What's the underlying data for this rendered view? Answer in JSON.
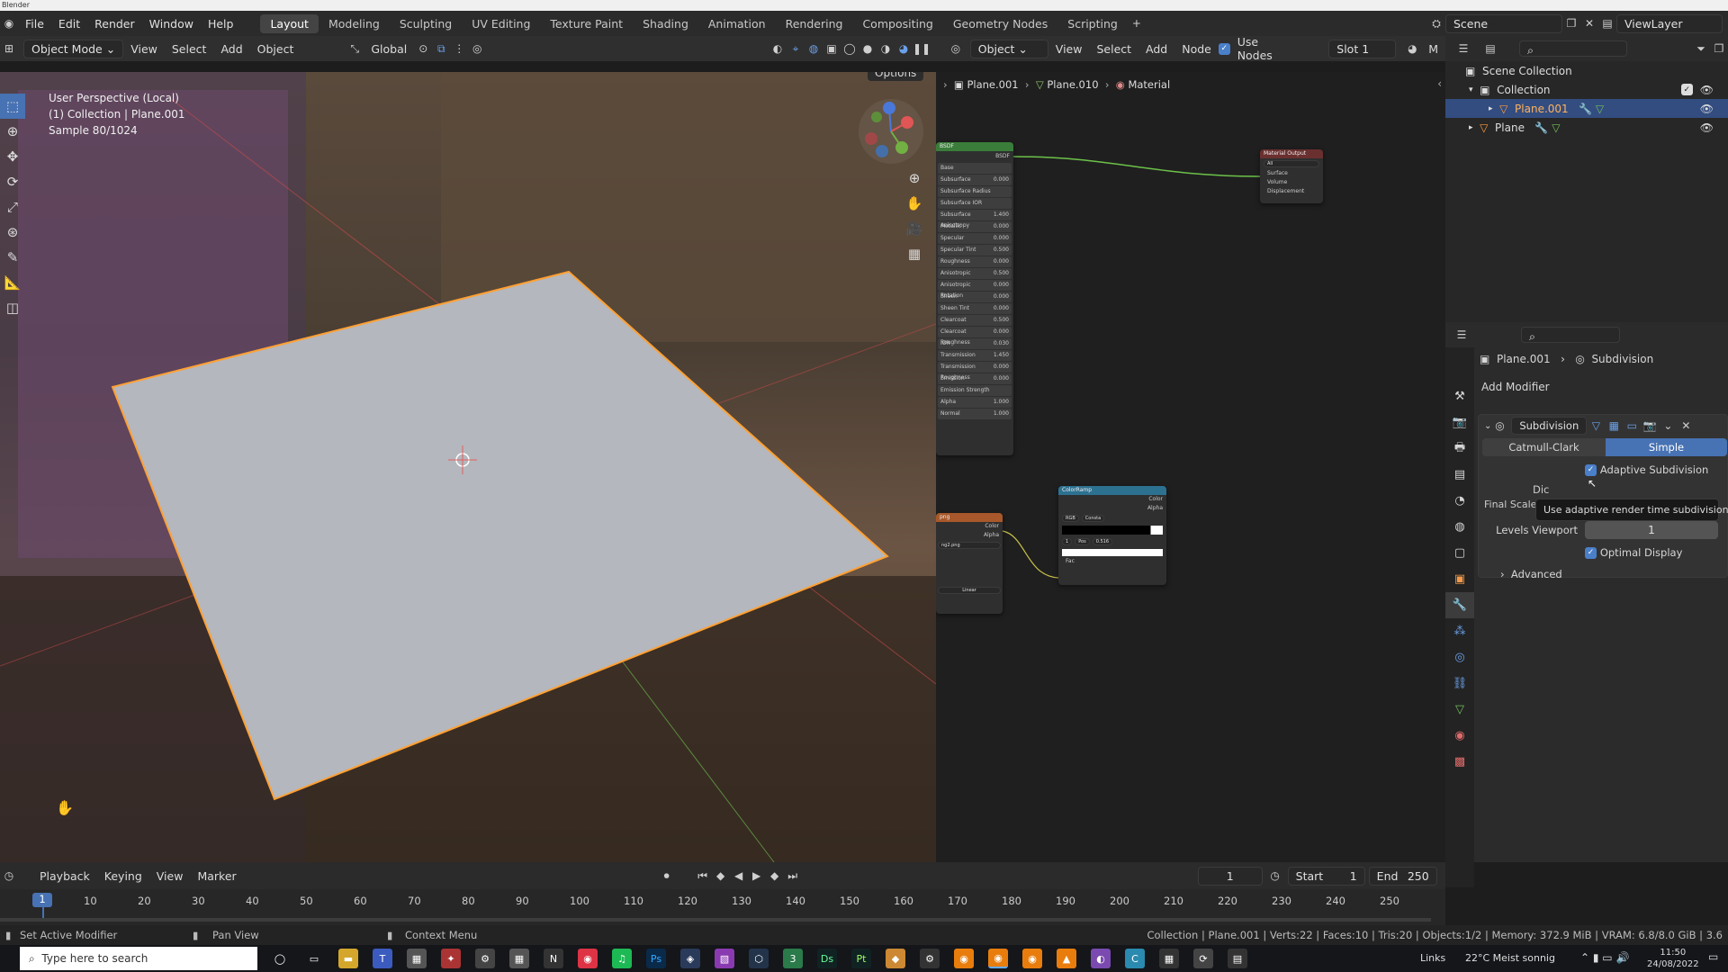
{
  "window": {
    "title": "Blender"
  },
  "menu": {
    "items": [
      "File",
      "Edit",
      "Render",
      "Window",
      "Help"
    ]
  },
  "workspaces": [
    "Layout",
    "Modeling",
    "Sculpting",
    "UV Editing",
    "Texture Paint",
    "Shading",
    "Animation",
    "Rendering",
    "Compositing",
    "Geometry Nodes",
    "Scripting"
  ],
  "active_workspace": "Layout",
  "scene": {
    "label": "Scene",
    "view_layer": "ViewLayer"
  },
  "viewport_header": {
    "mode": "Object Mode",
    "menus": [
      "View",
      "Select",
      "Add",
      "Object"
    ],
    "orientation": "Global",
    "options": "Options"
  },
  "viewport_overlay": {
    "line1": "User Perspective (Local)",
    "line2": "(1) Collection | Plane.001",
    "line3": "Sample 80/1024"
  },
  "node_header": {
    "type": "Object",
    "menus": [
      "View",
      "Select",
      "Add",
      "Node"
    ],
    "use_nodes": "Use Nodes",
    "slot": "Slot 1",
    "m": "M"
  },
  "node_breadcrumb": {
    "object": "Plane.001",
    "mesh": "Plane.010",
    "material": "Material"
  },
  "nodes": {
    "bsdf_head": "BSDF",
    "bsdf_out": "BSDF",
    "output_head": "Material Output",
    "output_target": "All",
    "output_sockets": [
      "Surface",
      "Volume",
      "Displacement"
    ],
    "ramp_head": "ColorRamp",
    "ramp_sockets": [
      "Color",
      "Alpha"
    ],
    "ramp_mode": "RGB",
    "ramp_interp": "Consta",
    "ramp_pos_label": "Pos",
    "ramp_pos": "0.516",
    "ramp_idx": "1",
    "ramp_fac": "Fac",
    "img_head": "png",
    "img_sockets": [
      "Color",
      "Alpha"
    ],
    "img_file": "ng2.png",
    "img_interp": "Linear",
    "bsdf_rows": [
      "Base",
      "Subsurface",
      "Subsurface Radius",
      "Subsurface IOR",
      "Subsurface Anisotropy",
      "Metallic",
      "Specular",
      "Specular Tint",
      "Roughness",
      "Anisotropic",
      "Anisotropic Rotation",
      "Sheen",
      "Sheen Tint",
      "Clearcoat",
      "Clearcoat Roughness",
      "IOR",
      "Transmission",
      "Transmission Roughness",
      "Emission",
      "Emission Strength",
      "Alpha",
      "Normal"
    ],
    "bsdf_vals": [
      "",
      "0.000",
      "",
      "",
      "1.400",
      "0.000",
      "0.000",
      "0.500",
      "0.000",
      "0.500",
      "0.000",
      "0.000",
      "0.000",
      "0.500",
      "0.000",
      "0.030",
      "1.450",
      "0.000",
      "0.000",
      "",
      "1.000",
      "1.000"
    ]
  },
  "outliner": {
    "root": "Scene Collection",
    "collection": "Collection",
    "items": [
      "Plane.001",
      "Plane"
    ]
  },
  "properties": {
    "object": "Plane.001",
    "modifier_crumb": "Subdivision",
    "add_modifier": "Add Modifier",
    "modifier_name": "Subdivision",
    "catmull": "Catmull-Clark",
    "simple": "Simple",
    "adaptive": "Adaptive Subdivision",
    "tooltip": "Use adaptive render time subdivision.",
    "dice_label": "Dic",
    "final_scale": "Final Scale: Render 0.50 px, Viewport 5.00 px",
    "levels_label": "Levels Viewport",
    "levels_value": "1",
    "optimal": "Optimal Display",
    "advanced": "Advanced"
  },
  "timeline": {
    "menus": [
      "Playback",
      "Keying",
      "View",
      "Marker"
    ],
    "current_frame": "1",
    "start_label": "Start",
    "start": "1",
    "end_label": "End",
    "end": "250",
    "ticks": [
      "10",
      "20",
      "30",
      "40",
      "50",
      "60",
      "70",
      "80",
      "90",
      "100",
      "110",
      "120",
      "130",
      "140",
      "150",
      "160",
      "170",
      "180",
      "190",
      "200",
      "210",
      "220",
      "230",
      "240",
      "250"
    ],
    "cursor": "1"
  },
  "status": {
    "left": "Set Active Modifier",
    "mid": "Pan View",
    "ctx": "Context Menu",
    "right": "Collection | Plane.001 | Verts:22 | Faces:10 | Tris:20 | Objects:1/2 | Memory: 372.9 MiB | VRAM: 6.8/8.0 GiB | 3.6"
  },
  "taskbar": {
    "search": "Type here to search",
    "links": "Links",
    "weather": "22°C  Meist sonnig",
    "time": "11:50",
    "date": "24/08/2022"
  },
  "colors": {
    "accent": "#4772b3",
    "selection": "#ffa033",
    "node_green": "#3a7d3a",
    "node_ramp": "#2d7190",
    "node_img": "#a8582a"
  }
}
